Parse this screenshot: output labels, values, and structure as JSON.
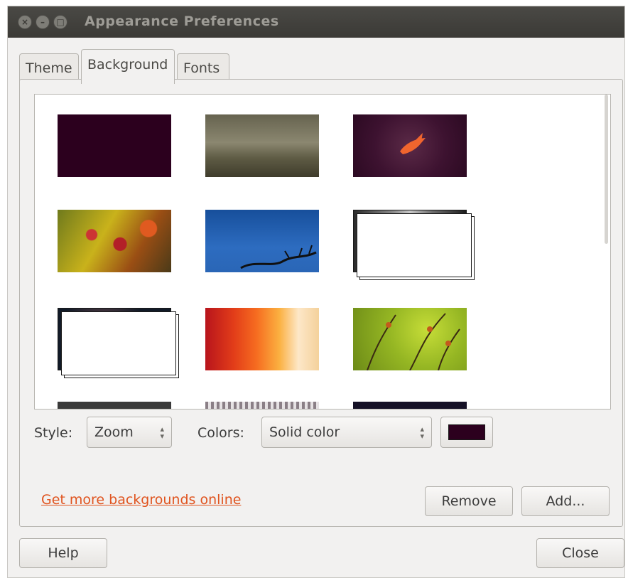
{
  "window": {
    "title": "Appearance Preferences"
  },
  "tabs": [
    {
      "label": "Theme",
      "selected": false
    },
    {
      "label": "Background",
      "selected": true
    },
    {
      "label": "Fonts",
      "selected": false
    }
  ],
  "background_tab": {
    "wallpapers": [
      {
        "icon": "wallpaper-solid-aubergine-thumbnail",
        "selected": false
      },
      {
        "icon": "wallpaper-windswept-tree-thumbnail",
        "selected": false
      },
      {
        "icon": "wallpaper-warty-bird-thumbnail",
        "selected": false
      },
      {
        "icon": "wallpaper-red-berries-thumbnail",
        "selected": false
      },
      {
        "icon": "wallpaper-blue-sky-branch-thumbnail",
        "selected": false
      },
      {
        "icon": "wallpaper-city-buildings-thumbnail",
        "selected": false
      },
      {
        "icon": "wallpaper-galaxy-thumbnail",
        "selected": false
      },
      {
        "icon": "wallpaper-orange-curtains-thumbnail",
        "selected": false
      },
      {
        "icon": "wallpaper-green-stems-thumbnail",
        "selected": false
      },
      {
        "icon": "wallpaper-partial-gray-thumbnail",
        "selected": false
      },
      {
        "icon": "wallpaper-partial-pattern-thumbnail",
        "selected": false
      },
      {
        "icon": "wallpaper-partial-dark-thumbnail",
        "selected": false
      }
    ],
    "style_label": "Style:",
    "style_value": "Zoom",
    "colors_label": "Colors:",
    "colors_value": "Solid color",
    "color_swatch": "#2c001e",
    "online_link": "Get more backgrounds online",
    "remove_button": "Remove",
    "add_button": "Add..."
  },
  "footer": {
    "help_button": "Help",
    "close_button": "Close"
  },
  "colors": {
    "titlebar": "#3b3a36",
    "link": "#e0541f",
    "dialog_bg": "#f2f1f0"
  }
}
